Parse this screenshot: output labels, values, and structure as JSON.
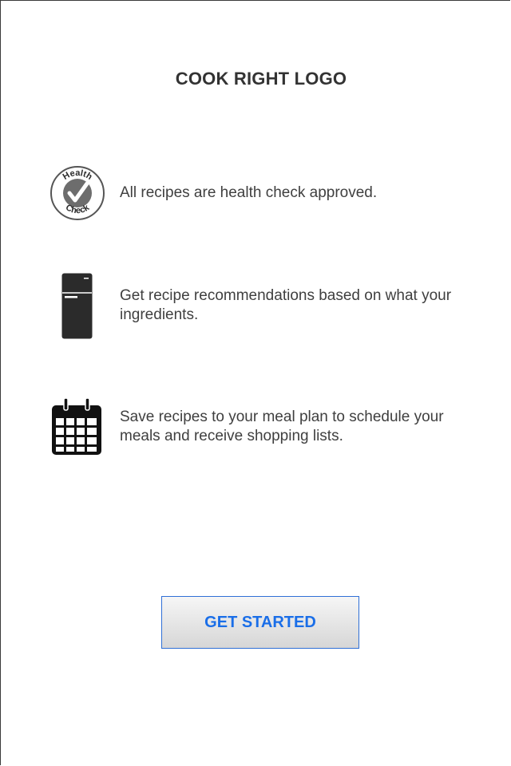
{
  "header": {
    "logo_text": "COOK RIGHT LOGO"
  },
  "features": [
    {
      "icon": "health-check-icon",
      "icon_text_top": "Health",
      "icon_text_bottom": "Check",
      "text": "All recipes are health check approved."
    },
    {
      "icon": "fridge-icon",
      "text": "Get recipe recommendations based on what your ingredients."
    },
    {
      "icon": "calendar-icon",
      "text": "Save recipes to your meal plan to schedule your meals and receive shopping lists."
    }
  ],
  "cta": {
    "label": "GET STARTED"
  },
  "colors": {
    "accent": "#1a6ee8",
    "text": "#3f3f3f",
    "icon": "#2b2b2b"
  }
}
